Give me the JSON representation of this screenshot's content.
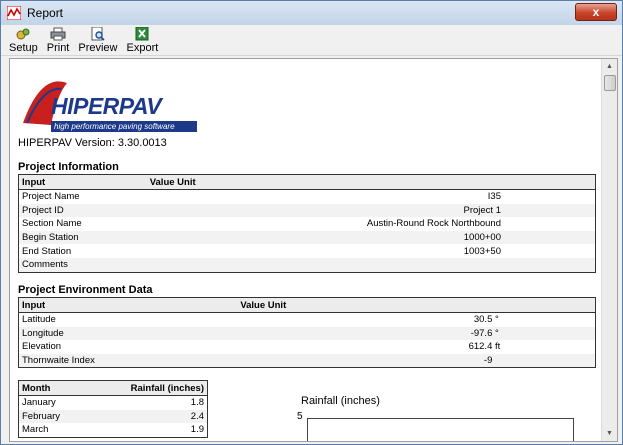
{
  "window": {
    "title": "Report",
    "close_label": "x"
  },
  "toolbar": {
    "items": [
      {
        "label": "Setup",
        "icon": "setup-icon"
      },
      {
        "label": "Print",
        "icon": "printer-icon"
      },
      {
        "label": "Preview",
        "icon": "preview-icon"
      },
      {
        "label": "Export",
        "icon": "excel-export-icon"
      }
    ]
  },
  "report": {
    "logo": {
      "word": "HIPERPAV",
      "tagline": "high performance paving software"
    },
    "version_line": "HIPERPAV Version:  3.30.0013",
    "project_info": {
      "title": "Project Information",
      "col_input": "Input",
      "col_value_unit": "Value Unit",
      "rows": [
        {
          "input": "Project Name",
          "value": "I35",
          "unit": ""
        },
        {
          "input": "Project ID",
          "value": "Project 1",
          "unit": ""
        },
        {
          "input": "Section Name",
          "value": "Austin-Round Rock Northbound",
          "unit": ""
        },
        {
          "input": "Begin Station",
          "value": "1000+00",
          "unit": ""
        },
        {
          "input": "End Station",
          "value": "1003+50",
          "unit": ""
        },
        {
          "input": "Comments",
          "value": "",
          "unit": ""
        }
      ]
    },
    "environment": {
      "title": "Project Environment Data",
      "col_input": "Input",
      "col_value_unit": "Value Unit",
      "rows": [
        {
          "input": "Latitude",
          "value": "30.5",
          "unit": "°"
        },
        {
          "input": "Longitude",
          "value": "-97.6",
          "unit": "°"
        },
        {
          "input": "Elevation",
          "value": "612.4",
          "unit": "ft"
        },
        {
          "input": "Thornwaite Index",
          "value": "-9",
          "unit": ""
        }
      ]
    },
    "rainfall_table": {
      "col_month": "Month",
      "col_rain": "Rainfall (inches)",
      "rows": [
        {
          "month": "January",
          "value": "1.8"
        },
        {
          "month": "February",
          "value": "2.4"
        },
        {
          "month": "March",
          "value": "1.9"
        }
      ]
    },
    "rainfall_chart": {
      "title": "Rainfall (inches)",
      "y_top_label": "5"
    }
  }
}
